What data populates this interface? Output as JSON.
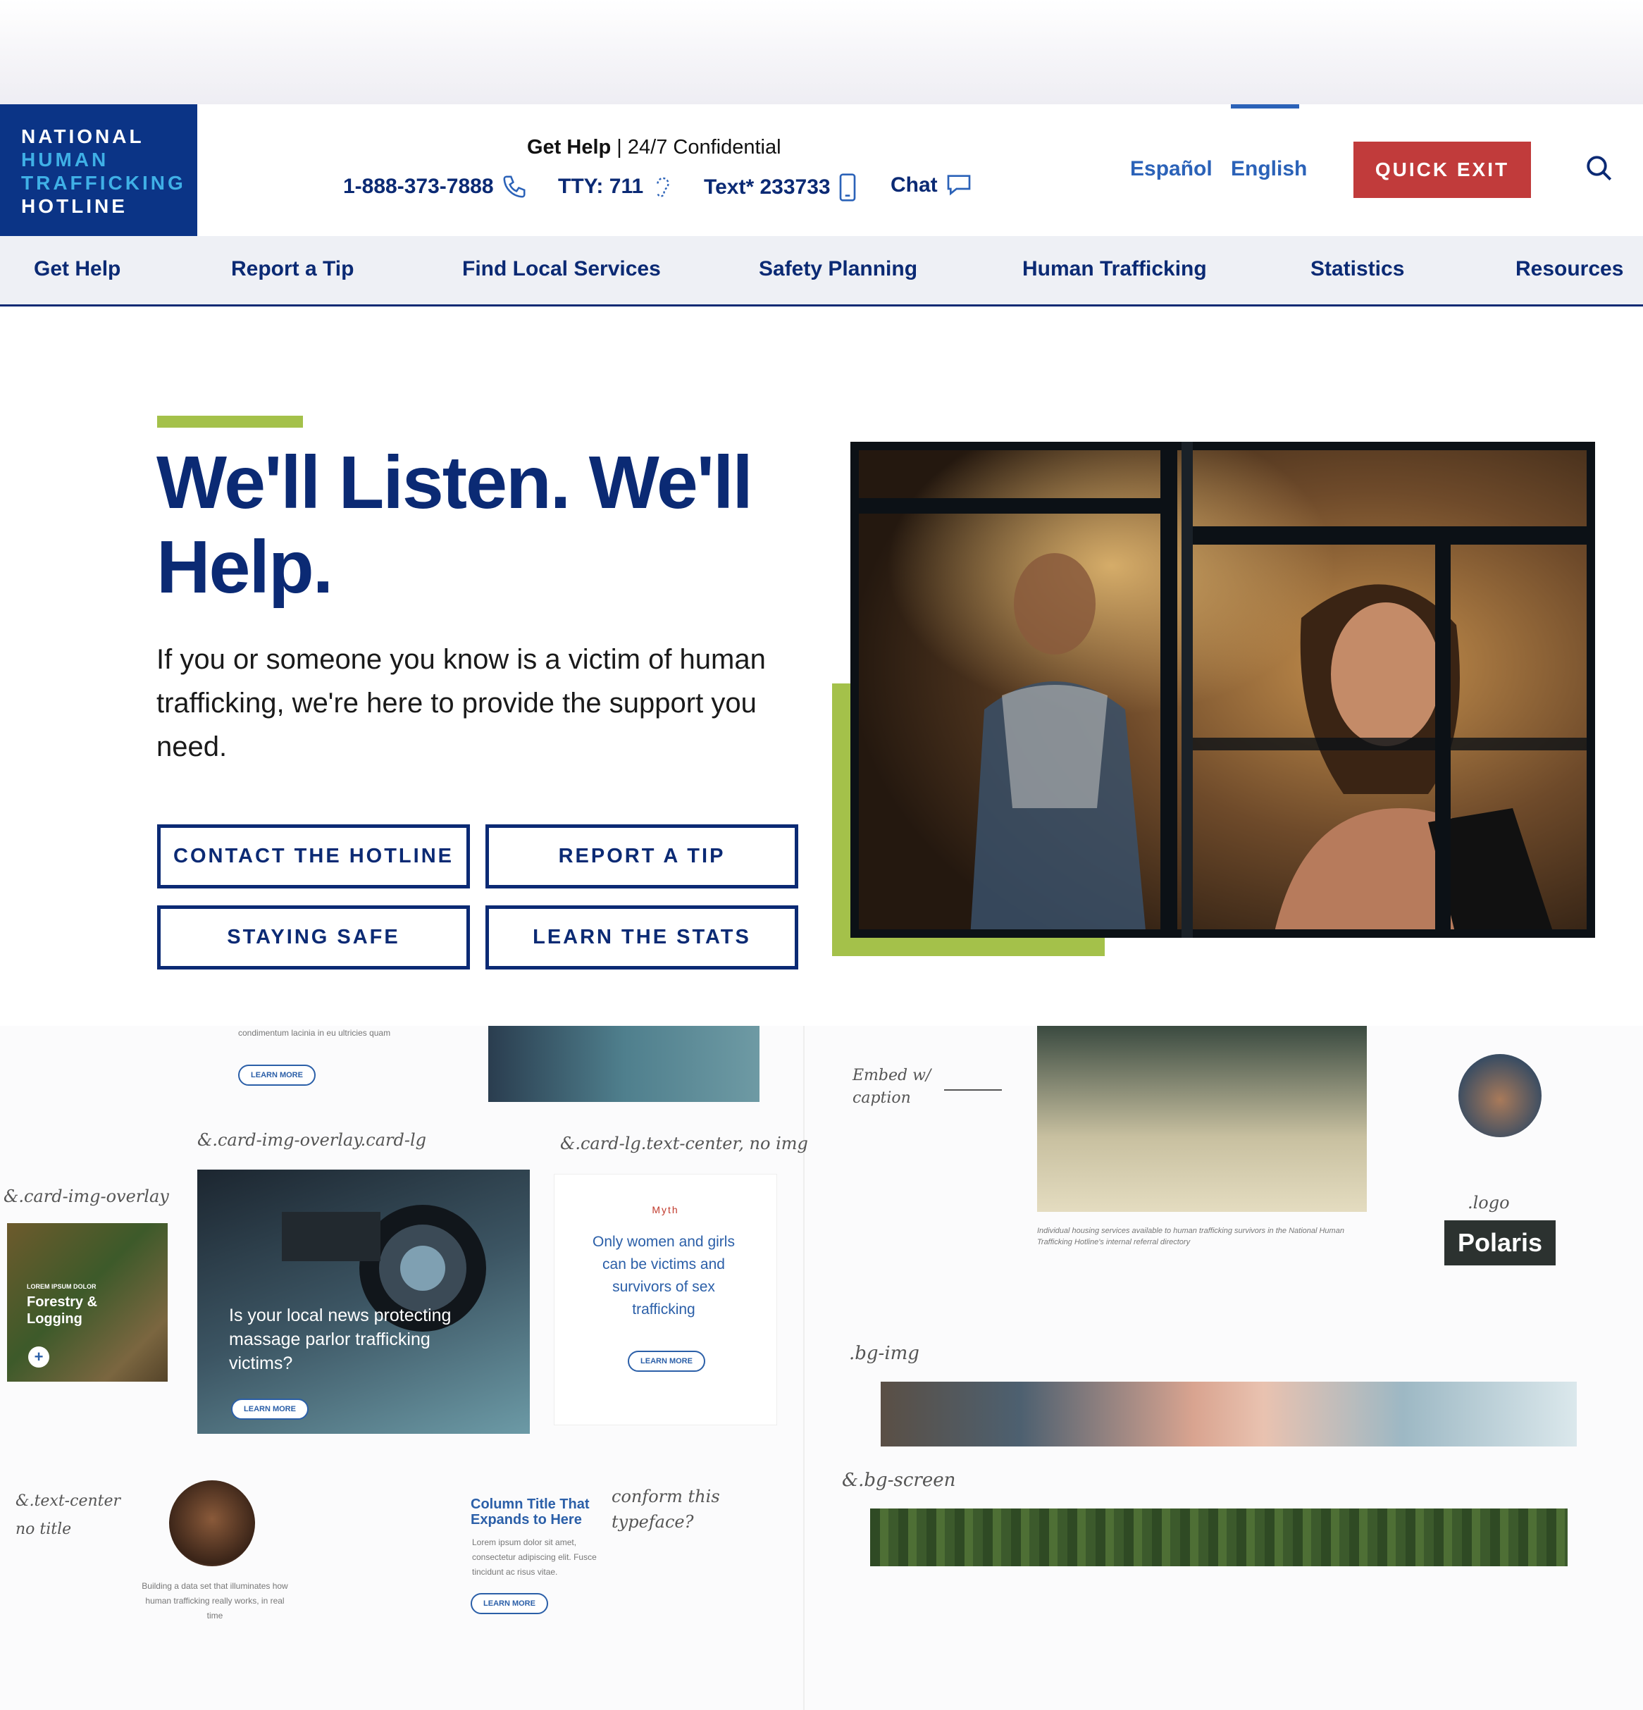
{
  "header": {
    "logo": [
      "NATIONAL",
      "HUMAN",
      "TRAFFICKING",
      "HOTLINE"
    ],
    "get_help_bold": "Get Help",
    "get_help_rest": " | 24/7 Confidential",
    "phone": "1-888-373-7888",
    "tty": "TTY: 711",
    "text": "Text* 233733",
    "chat": "Chat",
    "lang_es": "Español",
    "lang_en": "English",
    "quick_exit": "QUICK EXIT"
  },
  "nav": [
    "Get Help",
    "Report a Tip",
    "Find Local Services",
    "Safety Planning",
    "Human Trafficking",
    "Statistics",
    "Resources"
  ],
  "hero": {
    "title_line1": "We'll Listen. We'll",
    "title_line2": "Help.",
    "text": "If you or someone you know is a victim of human trafficking, we're here to provide the support you need.",
    "buttons": [
      "CONTACT THE HOTLINE",
      "REPORT A TIP",
      "STAYING SAFE",
      "LEARN THE STATS"
    ]
  },
  "sketch": {
    "condimentum": "condimentum lacinia in eu ultricies quam",
    "learn_more": "LEARN MORE",
    "note_overlay": "&.card-img-overlay",
    "note_overlay_lg": "&.card-img-overlay.card-lg",
    "note_text_center": "&.card-lg.text-center, no img",
    "note_embed": "Embed w/ caption",
    "note_logo": ".logo",
    "note_bg_img": ".bg-img",
    "note_bg_screen": "&.bg-screen",
    "note_text_center2": "&.text-center no title",
    "note_conform": "conform this typeface?",
    "forestry_small": "LOREM IPSUM DOLOR",
    "forestry_title": "Forestry & Logging",
    "news_title": "Is your local news protecting massage parlor trafficking victims?",
    "myth_label": "Myth",
    "myth_text": "Only women and girls can be victims and survivors of sex trafficking",
    "caption": "Individual housing services available to human trafficking survivors in the National Human Trafficking Hotline's internal referral directory",
    "polaris": "Polaris",
    "data_text": "Building a data set that illuminates how human trafficking really works, in real time",
    "column_title": "Column Title That Expands to Here",
    "column_body": "Lorem ipsum dolor sit amet, consectetur adipiscing elit. Fusce tincidunt ac risus vitae."
  },
  "colors": {
    "navy": "#0b3486",
    "nav_text": "#0b2a74",
    "accent_green": "#a4c14a",
    "quick_exit_red": "#c13b3b",
    "link_blue": "#2b62b8"
  }
}
